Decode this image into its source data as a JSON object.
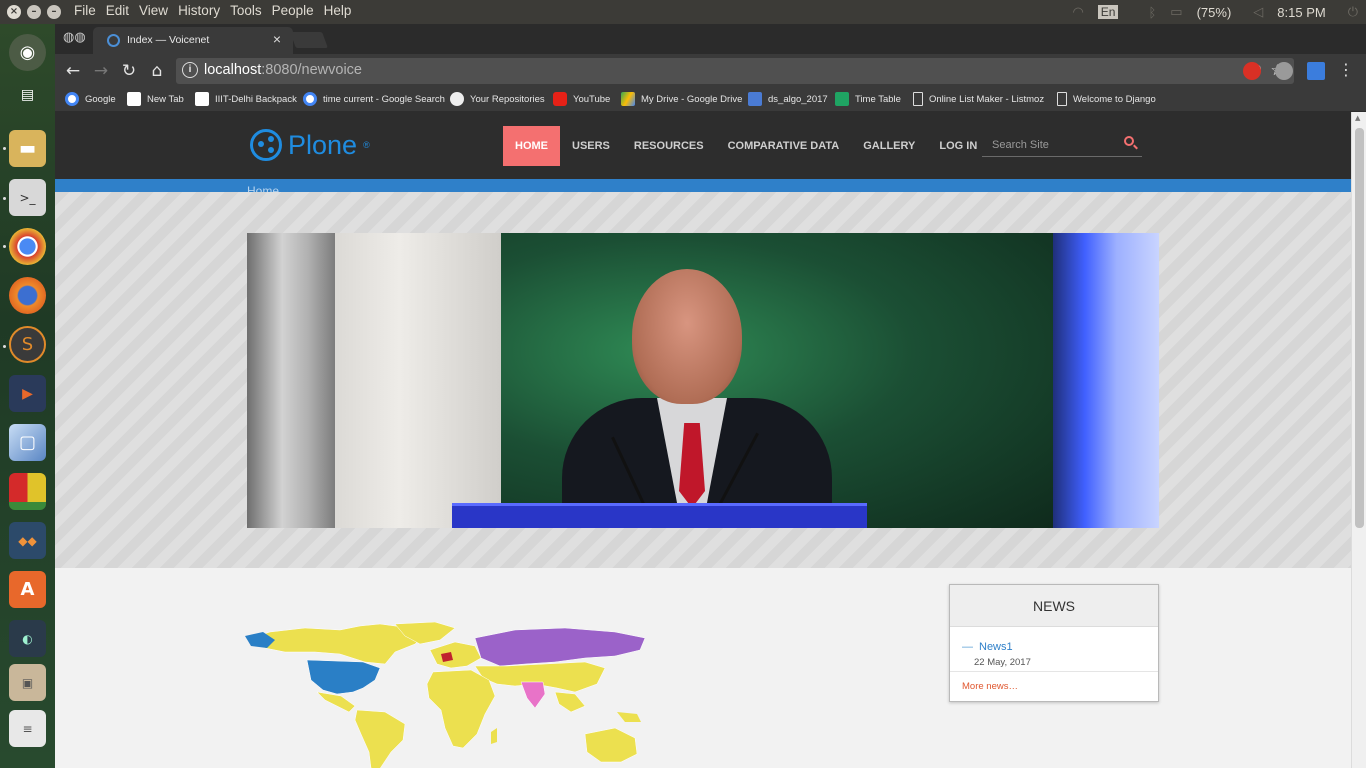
{
  "os_menu": {
    "items": [
      "File",
      "Edit",
      "View",
      "History",
      "Tools",
      "People",
      "Help"
    ],
    "lang": "En",
    "battery": "(75%)",
    "clock": "8:15 PM"
  },
  "browser": {
    "tab_title": "Index — Voicenet",
    "url_host": "localhost",
    "url_rest": ":8080/newvoice",
    "bookmarks": [
      "Google",
      "New Tab",
      "IIIT-Delhi Backpack",
      "time current - Google Search",
      "Your Repositories",
      "YouTube",
      "My Drive - Google Drive",
      "ds_algo_2017",
      "Time Table",
      "Online List Maker - Listmoz",
      "Welcome to Django"
    ]
  },
  "site": {
    "logo_text": "Plone",
    "logo_mark": "®",
    "nav": [
      "HOME",
      "USERS",
      "RESOURCES",
      "COMPARATIVE DATA",
      "GALLERY",
      "LOG IN"
    ],
    "active_nav": "HOME",
    "search_placeholder": "Search Site",
    "breadcrumb": "Home",
    "news": {
      "title": "NEWS",
      "items": [
        {
          "title": "News1",
          "date": "22 May, 2017"
        }
      ],
      "more": "More news…"
    }
  },
  "colors": {
    "accent_nav": "#f47070",
    "brand_blue": "#1f8ce0",
    "bar_blue": "#2f80c9",
    "map_yellow": "#ece04f",
    "map_blue": "#2a7fc6",
    "map_purple": "#9b62c9",
    "map_pink": "#e873c8",
    "map_red": "#c0232e"
  },
  "icons": {
    "launcher": [
      "ubuntu-logo-icon",
      "workspace-icon",
      "files-icon",
      "terminal-icon",
      "chrome-icon",
      "firefox-icon",
      "sublime-icon",
      "player-icon",
      "virtualbox-icon",
      "tiles-icon",
      "package-icon",
      "software-center-icon",
      "toggle-icon",
      "archive-icon",
      "files-stack-icon"
    ]
  }
}
